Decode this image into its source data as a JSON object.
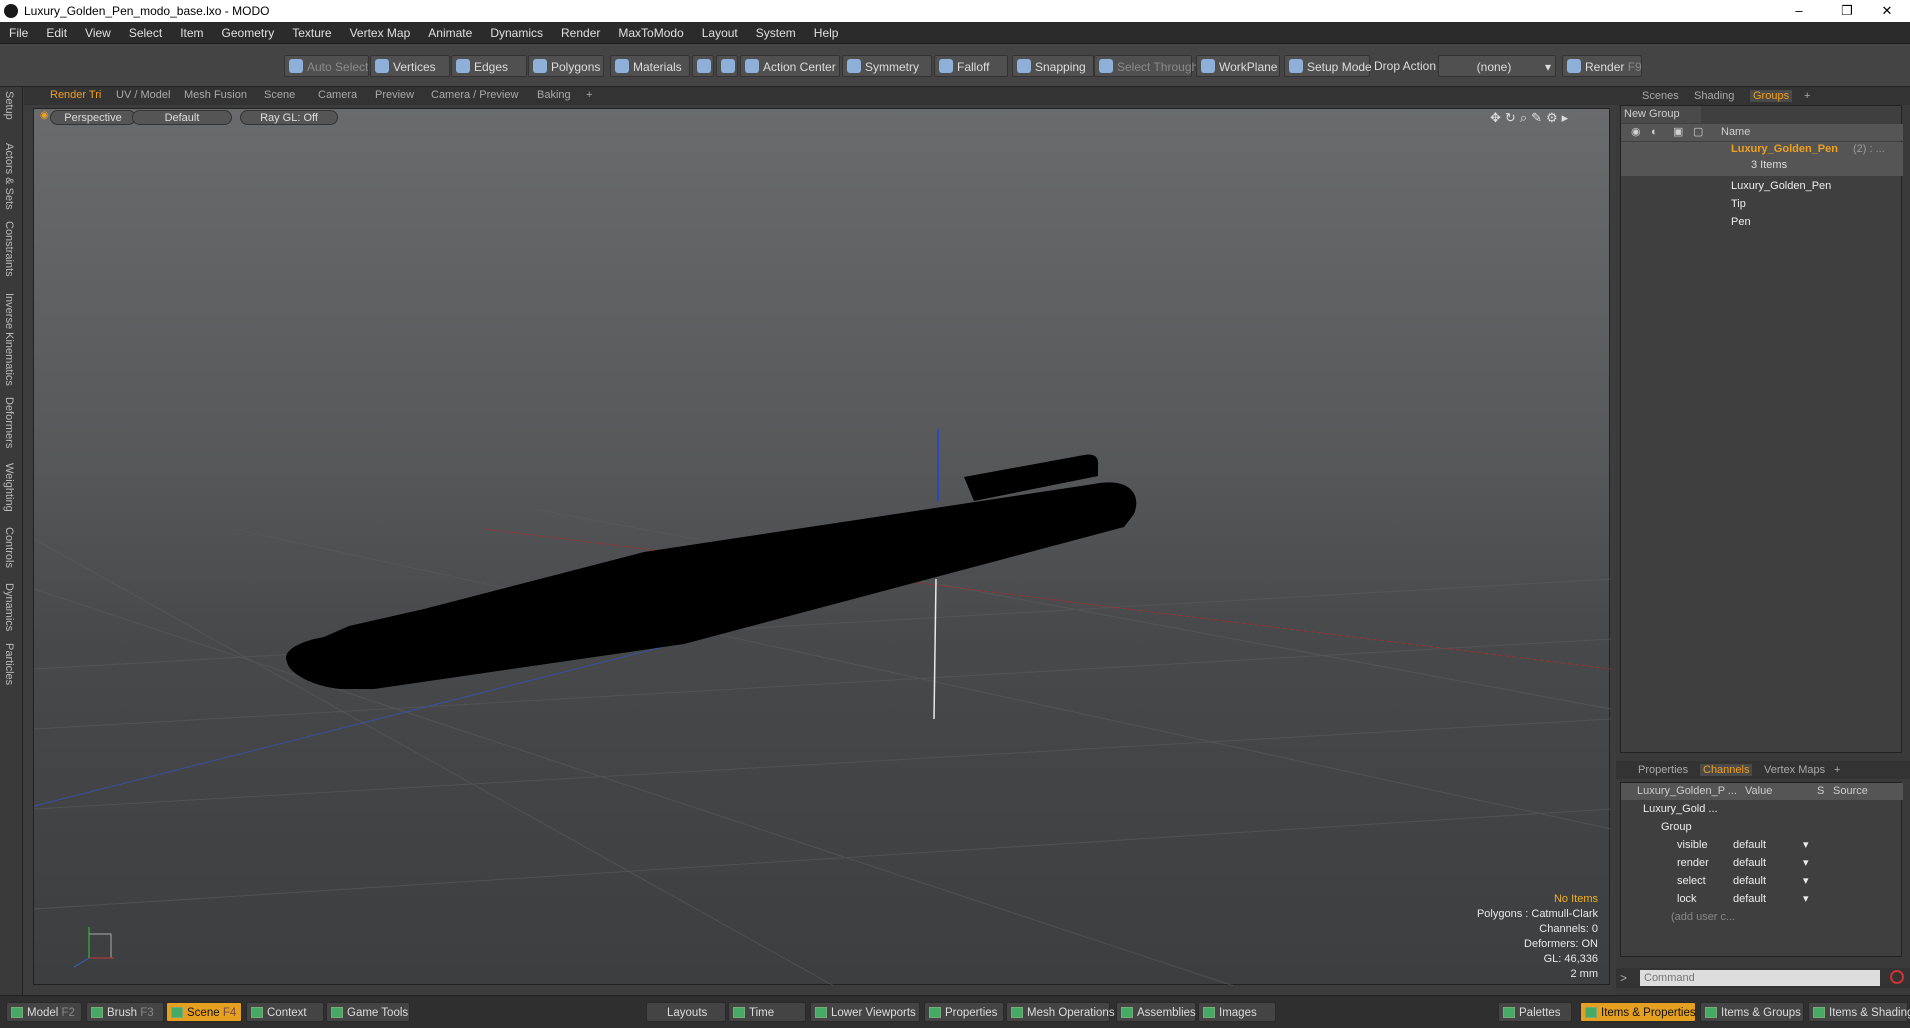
{
  "window": {
    "title": "Luxury_Golden_Pen_modo_base.lxo - MODO",
    "minimize": "–",
    "restore": "❐",
    "close": "✕"
  },
  "menu": [
    "File",
    "Edit",
    "View",
    "Select",
    "Item",
    "Geometry",
    "Texture",
    "Vertex Map",
    "Animate",
    "Dynamics",
    "Render",
    "MaxToModo",
    "Layout",
    "System",
    "Help"
  ],
  "toolbar": {
    "auto_select": "Auto Select",
    "vertices": "Vertices",
    "edges": "Edges",
    "polygons": "Polygons",
    "materials": "Materials",
    "action_center": "Action Center",
    "symmetry": "Symmetry",
    "falloff": "Falloff",
    "snapping": "Snapping",
    "select_through": "Select Through",
    "workplane": "WorkPlane",
    "setup_mode": "Setup Mode",
    "drop_action": "Drop Action",
    "drop_value": "(none)",
    "render": "Render",
    "render_key": "F9"
  },
  "left_tabs": [
    "Setup",
    "Actors & Sets",
    "Constraints",
    "Inverse Kinematics",
    "Deformers",
    "Weighting",
    "Controls",
    "Dynamics",
    "Particles"
  ],
  "viewport_tabs": [
    "Render Tri",
    "UV / Model",
    "Mesh Fusion",
    "Scene",
    "Camera",
    "Preview",
    "Camera / Preview",
    "Baking",
    "+"
  ],
  "viewport": {
    "view": "Perspective",
    "shading": "Default",
    "raygl": "Ray GL: Off",
    "info": {
      "no_items": "No Items",
      "polygons": "Polygons : Catmull-Clark",
      "channels": "Channels: 0",
      "deformers": "Deformers: ON",
      "gl": "GL: 46,336",
      "unit": "2 mm"
    }
  },
  "right_tabs": [
    "Scenes",
    "Shading",
    "Groups",
    "+"
  ],
  "groups": {
    "new_group": "New Group",
    "name_col": "Name",
    "group_name": "Luxury_Golden_Pen",
    "group_count": "(2) : ...",
    "items_count": "3 Items",
    "children": [
      "Luxury_Golden_Pen",
      "Tip",
      "Pen"
    ]
  },
  "channel_tabs": [
    "Properties",
    "Channels",
    "Vertex Maps",
    "+"
  ],
  "channels": {
    "col_item": "Luxury_Golden_P ...",
    "col_value": "Value",
    "col_s": "S",
    "col_source": "Source",
    "item": "Luxury_Gold ...",
    "group": "Group",
    "rows": [
      {
        "name": "visible",
        "value": "default"
      },
      {
        "name": "render",
        "value": "default"
      },
      {
        "name": "select",
        "value": "default"
      },
      {
        "name": "lock",
        "value": "default"
      }
    ],
    "add_user": "(add user c..."
  },
  "command": {
    "prompt": ">",
    "placeholder": "Command"
  },
  "bottom": {
    "model": "Model",
    "model_key": "F2",
    "brush": "Brush",
    "brush_key": "F3",
    "scene": "Scene",
    "scene_key": "F4",
    "context": "Context",
    "game_tools": "Game Tools",
    "layouts": "Layouts",
    "time": "Time",
    "lower_viewports": "Lower Viewports",
    "properties": "Properties",
    "mesh_operations": "Mesh Operations",
    "assemblies": "Assemblies",
    "images": "Images",
    "palettes": "Palettes",
    "items_properties": "Items & Properties",
    "items_groups": "Items & Groups",
    "items_shading": "Items & Shading"
  },
  "colors": {
    "accent": "#f0a020",
    "background": "#3c3c3c"
  }
}
